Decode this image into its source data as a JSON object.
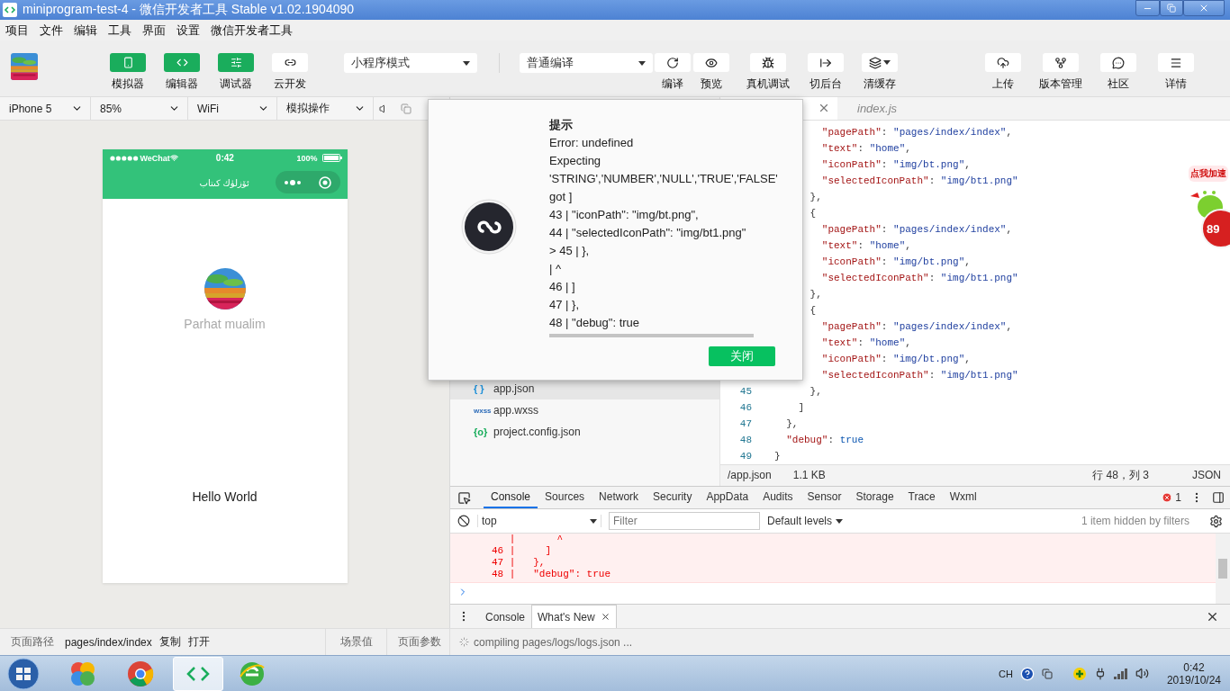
{
  "window": {
    "title": "miniprogram-test-4 - 微信开发者工具 Stable v1.02.1904090"
  },
  "menu": [
    "项目",
    "文件",
    "编辑",
    "工具",
    "界面",
    "设置",
    "微信开发者工具"
  ],
  "toolbar": {
    "view_buttons": [
      {
        "label": "模拟器",
        "selected": true
      },
      {
        "label": "编辑器",
        "selected": true
      },
      {
        "label": "调试器",
        "selected": true
      },
      {
        "label": "云开发",
        "selected": false
      }
    ],
    "mode_select": "小程序模式",
    "compile_select": "普通编译",
    "actions": [
      {
        "label": "编译"
      },
      {
        "label": "预览"
      },
      {
        "label": "真机调试"
      },
      {
        "label": "切后台"
      },
      {
        "label": "清缓存"
      }
    ],
    "right_actions": [
      {
        "label": "上传"
      },
      {
        "label": "版本管理"
      },
      {
        "label": "社区"
      },
      {
        "label": "详情"
      }
    ]
  },
  "simulator": {
    "selects": [
      "iPhone 5",
      "85%",
      "WiFi",
      "模拟操作"
    ],
    "phone": {
      "carrier": "WeChat",
      "time": "0:42",
      "battery": "100%",
      "nav_title": "ئۆزلۈك كىتاب",
      "user_name": "Parhat mualim",
      "body_text": "Hello World"
    }
  },
  "file_tree": [
    {
      "kind": "json",
      "icon": "{ }",
      "name": "app.json",
      "selected": true
    },
    {
      "kind": "wxss",
      "icon": "wxss",
      "name": "app.wxss",
      "selected": false
    },
    {
      "kind": "config",
      "icon": "{o}",
      "name": "project.config.json",
      "selected": false
    }
  ],
  "editor": {
    "tabs": [
      {
        "selected": true
      },
      {
        "label": "index.js",
        "selected": false
      }
    ],
    "code_lines": [
      {
        "tokens": [
          {
            "kind": "key",
            "text": "        \"pagePath\""
          },
          {
            "kind": "punct",
            "text": ": "
          },
          {
            "kind": "string",
            "text": "\"pages/index/index\""
          },
          {
            "kind": "punct",
            "text": ","
          }
        ]
      },
      {
        "tokens": [
          {
            "kind": "key",
            "text": "        \"text\""
          },
          {
            "kind": "punct",
            "text": ": "
          },
          {
            "kind": "string",
            "text": "\"home\""
          },
          {
            "kind": "punct",
            "text": ","
          }
        ]
      },
      {
        "tokens": [
          {
            "kind": "key",
            "text": "        \"iconPath\""
          },
          {
            "kind": "punct",
            "text": ": "
          },
          {
            "kind": "string",
            "text": "\"img/bt.png\""
          },
          {
            "kind": "punct",
            "text": ","
          }
        ]
      },
      {
        "tokens": [
          {
            "kind": "key",
            "text": "        \"selectedIconPath\""
          },
          {
            "kind": "punct",
            "text": ": "
          },
          {
            "kind": "string",
            "text": "\"img/bt1.png\""
          }
        ]
      },
      {
        "tokens": [
          {
            "kind": "punct",
            "text": "      },"
          }
        ]
      },
      {
        "tokens": [
          {
            "kind": "punct",
            "text": "      {"
          }
        ]
      },
      {
        "tokens": [
          {
            "kind": "key",
            "text": "        \"pagePath\""
          },
          {
            "kind": "punct",
            "text": ": "
          },
          {
            "kind": "string",
            "text": "\"pages/index/index\""
          },
          {
            "kind": "punct",
            "text": ","
          }
        ]
      },
      {
        "tokens": [
          {
            "kind": "key",
            "text": "        \"text\""
          },
          {
            "kind": "punct",
            "text": ": "
          },
          {
            "kind": "string",
            "text": "\"home\""
          },
          {
            "kind": "punct",
            "text": ","
          }
        ]
      },
      {
        "tokens": [
          {
            "kind": "key",
            "text": "        \"iconPath\""
          },
          {
            "kind": "punct",
            "text": ": "
          },
          {
            "kind": "string",
            "text": "\"img/bt.png\""
          },
          {
            "kind": "punct",
            "text": ","
          }
        ]
      },
      {
        "tokens": [
          {
            "kind": "key",
            "text": "        \"selectedIconPath\""
          },
          {
            "kind": "punct",
            "text": ": "
          },
          {
            "kind": "string",
            "text": "\"img/bt1.png\""
          }
        ]
      },
      {
        "tokens": [
          {
            "kind": "punct",
            "text": "      },"
          }
        ]
      },
      {
        "tokens": [
          {
            "kind": "punct",
            "text": "      {"
          }
        ]
      },
      {
        "tokens": [
          {
            "kind": "key",
            "text": "        \"pagePath\""
          },
          {
            "kind": "punct",
            "text": ": "
          },
          {
            "kind": "string",
            "text": "\"pages/index/index\""
          },
          {
            "kind": "punct",
            "text": ","
          }
        ]
      },
      {
        "tokens": [
          {
            "kind": "key",
            "text": "        \"text\""
          },
          {
            "kind": "punct",
            "text": ": "
          },
          {
            "kind": "string",
            "text": "\"home\""
          },
          {
            "kind": "punct",
            "text": ","
          }
        ]
      },
      {
        "tokens": [
          {
            "kind": "key",
            "text": "        \"iconPath\""
          },
          {
            "kind": "punct",
            "text": ": "
          },
          {
            "kind": "string",
            "text": "\"img/bt.png\""
          },
          {
            "kind": "punct",
            "text": ","
          }
        ]
      },
      {
        "tokens": [
          {
            "kind": "key",
            "text": "        \"selectedIconPath\""
          },
          {
            "kind": "punct",
            "text": ": "
          },
          {
            "kind": "string",
            "text": "\"img/bt1.png\""
          }
        ]
      },
      {
        "number": "45",
        "tokens": [
          {
            "kind": "punct",
            "text": "      },"
          }
        ]
      },
      {
        "number": "46",
        "tokens": [
          {
            "kind": "punct",
            "text": "    ]"
          }
        ]
      },
      {
        "number": "47",
        "tokens": [
          {
            "kind": "punct",
            "text": "  },"
          }
        ]
      },
      {
        "number": "48",
        "tokens": [
          {
            "kind": "key",
            "text": "  \"debug\""
          },
          {
            "kind": "punct",
            "text": ": "
          },
          {
            "kind": "bool",
            "text": "true"
          }
        ]
      },
      {
        "number": "49",
        "tokens": [
          {
            "kind": "punct",
            "text": "}"
          }
        ]
      }
    ],
    "status": {
      "path": "/app.json",
      "size": "1.1 KB",
      "position": "行 48，列 3",
      "language": "JSON"
    }
  },
  "devtools": {
    "tabs": [
      {
        "label": "Console",
        "selected": true
      },
      {
        "label": "Sources",
        "selected": false
      },
      {
        "label": "Network",
        "selected": false
      },
      {
        "label": "Security",
        "selected": false
      },
      {
        "label": "AppData",
        "selected": false
      },
      {
        "label": "Audits",
        "selected": false
      },
      {
        "label": "Sensor",
        "selected": false
      },
      {
        "label": "Storage",
        "selected": false
      },
      {
        "label": "Trace",
        "selected": false
      },
      {
        "label": "Wxml",
        "selected": false
      }
    ],
    "error_count": "1",
    "context": "top",
    "filter_placeholder": "Filter",
    "levels": "Default levels",
    "hidden_note": "1 item hidden by filters",
    "console_lines": [
      "   |       ^",
      "46 |     ]",
      "47 |   },",
      "48 |   \"debug\": true"
    ],
    "drawer_tabs": [
      {
        "label": "Console",
        "selected": false
      },
      {
        "label": "What's New",
        "selected": true
      }
    ]
  },
  "dialog": {
    "title": "提示",
    "lines": [
      "Error: undefined",
      "Expecting",
      "'STRING','NUMBER','NULL','TRUE','FALSE'",
      "got ]",
      "43 | \"iconPath\": \"img/bt.png\",",
      "44 | \"selectedIconPath\": \"img/bt1.png\"",
      "> 45 | },",
      "| ^",
      "46 | ]",
      "47 | },",
      "48 | \"debug\": true"
    ],
    "button": "关闭"
  },
  "widget": {
    "bubble": "点我加速",
    "count": "89"
  },
  "status_bar": {
    "page_path_label": "页面路径",
    "page_path": "pages/index/index",
    "copy": "复制",
    "open": "打开",
    "scene": "场景值",
    "params": "页面参数",
    "compiling": "compiling pages/logs/logs.json ..."
  },
  "taskbar": {
    "apps": [
      {
        "selected": false
      },
      {
        "selected": false
      },
      {
        "selected": true
      },
      {
        "selected": false
      }
    ],
    "input": "CH",
    "time": "0:42",
    "date": "2019/10/24"
  }
}
